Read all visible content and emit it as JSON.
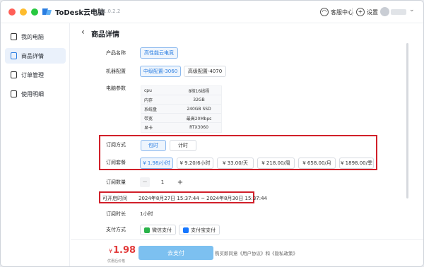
{
  "window": {
    "app_name": "ToDesk云电脑",
    "version": "V1.0.2.2",
    "support_label": "客服中心",
    "settings_label": "设置",
    "user_chevron": "⌄"
  },
  "sidebar": {
    "items": [
      {
        "label": "我的电脑",
        "icon": "computer-icon"
      },
      {
        "label": "商品详情",
        "icon": "document-icon"
      },
      {
        "label": "订单管理",
        "icon": "order-icon"
      },
      {
        "label": "使用明细",
        "icon": "list-icon"
      }
    ]
  },
  "page": {
    "back": "‹",
    "title": "商品详情"
  },
  "product": {
    "name_label": "产品名称",
    "name_value": "高性能云电竞",
    "config_label": "机器配置",
    "configs": [
      "中级配置-3060",
      "高级配置-4070"
    ],
    "params_label": "电脑参数",
    "params": [
      {
        "key": "cpu",
        "value": "8核16线程"
      },
      {
        "key": "内存",
        "value": "32GB"
      },
      {
        "key": "系统盘",
        "value": "240GB SSD"
      },
      {
        "key": "带宽",
        "value": "最高20Mbps"
      },
      {
        "key": "显卡",
        "value": "RTX3060"
      }
    ]
  },
  "subscription": {
    "mode_label": "订阅方式",
    "modes": [
      "包时",
      "计时"
    ],
    "plan_label": "订阅套餐",
    "plans": [
      "¥ 1.98/小时",
      "¥ 9.20/6小时",
      "¥ 33.00/天",
      "¥ 218.00/周",
      "¥ 658.00/月",
      "¥ 1898.00/季"
    ],
    "qty_label": "订阅数量",
    "qty_minus": "−",
    "qty_value": "1",
    "qty_plus": "+",
    "open_label": "可开启时间",
    "open_value": "2024年8月27日 15:37:44 ~ 2024年8月30日 15:37:44",
    "duration_label": "订阅时长",
    "duration_value": "1小时",
    "pay_label": "支付方式",
    "pay_methods": [
      "微信支付",
      "支付宝支付"
    ]
  },
  "footer": {
    "currency": "¥",
    "price": "1.98",
    "price_note": "优惠后价格",
    "pay_button": "去支付",
    "agreement": "购买即同意《用户协议》和《隐私政策》"
  },
  "colors": {
    "accent": "#2a7de1",
    "highlight_box": "#d1202a",
    "price": "#e23b3b",
    "pay_button": "#7cc0f0"
  }
}
